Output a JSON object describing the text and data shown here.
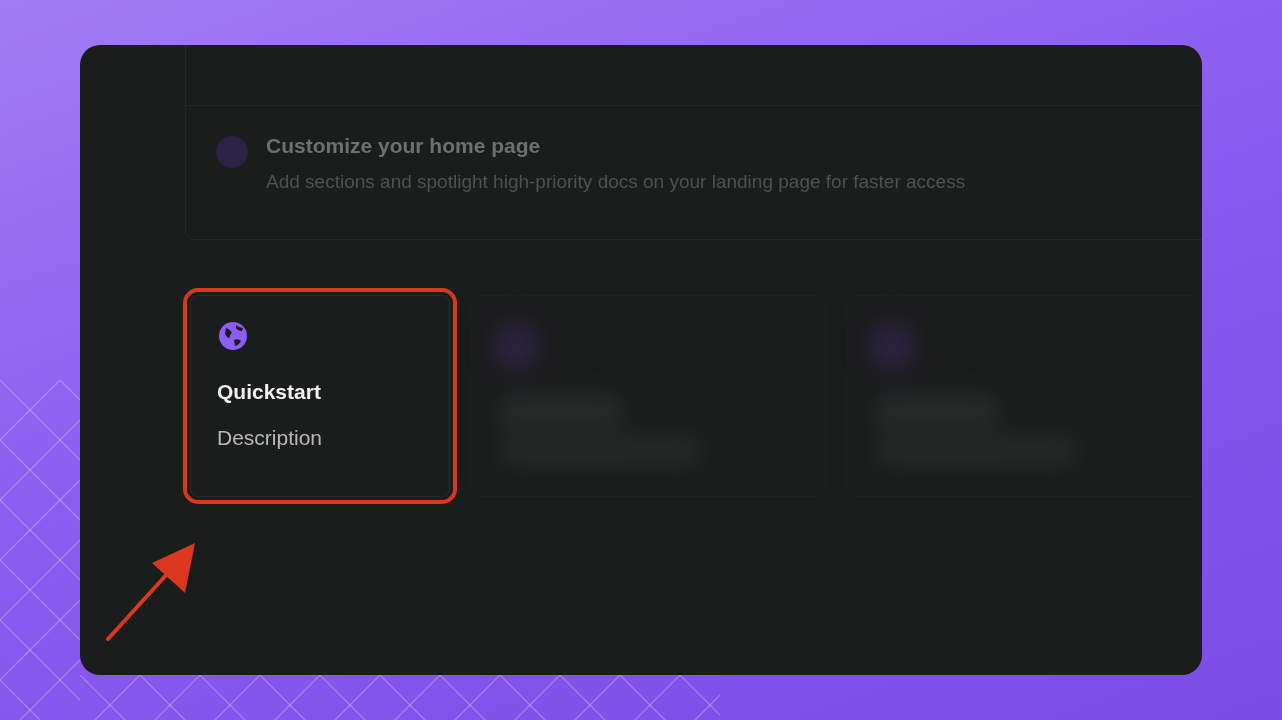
{
  "checklist": {
    "items": [
      {
        "title": "Customize your home page",
        "description": "Add sections and spotlight high-priority docs on your landing page for faster access"
      }
    ]
  },
  "cards": [
    {
      "kind": "card",
      "title": "Quickstart",
      "description": "Description",
      "highlighted": true
    },
    {
      "kind": "blurred"
    },
    {
      "kind": "blurred"
    }
  ]
}
